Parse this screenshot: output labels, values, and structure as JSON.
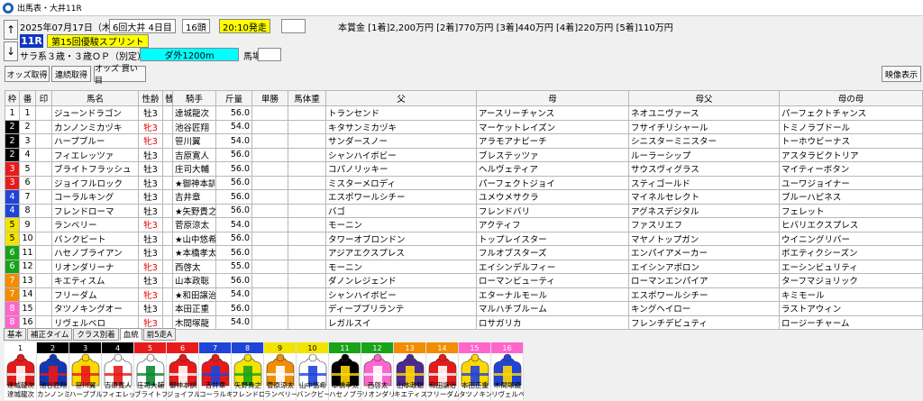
{
  "window": {
    "title": "出馬表・大井11R"
  },
  "header": {
    "date": "2025年07月17日（木）",
    "meeting": "6回大井 4日目",
    "runners": "16頭",
    "post_time": "20:10発走",
    "race_no": "11R",
    "race_name": "第15回優駿スプリント",
    "conditions": "サラ系３歳・３歳ＯＰ（別定）",
    "course": "ダ外1200m",
    "going_label": "馬場：",
    "prize": "本賞金 [1着]2,200万円 [2着]770万円 [3着]440万円 [4着]220万円 [5着]110万円"
  },
  "toolbar": {
    "odds_fetch": "オッズ取得",
    "auto_fetch": "連続取得",
    "odds_buy": "オッズ 買い目",
    "video": "映像表示"
  },
  "columns": [
    "枠",
    "番",
    "印",
    "馬名",
    "性齢",
    "替",
    "騎手",
    "斤量",
    "単勝",
    "馬体重",
    "父",
    "母",
    "母父",
    "母の母"
  ],
  "colors": {
    "frame": [
      "#ffffff",
      "#000000",
      "#e81b1b",
      "#1f44d8",
      "#f2e300",
      "#18a319",
      "#f28c00",
      "#ff66cc"
    ],
    "frame_text": [
      "#000000",
      "#ffffff",
      "#ffffff",
      "#ffffff",
      "#000000",
      "#ffffff",
      "#ffffff",
      "#ffffff"
    ],
    "accent": "#1136c2",
    "race_name_bg": "#ffff00",
    "course_bg": "#00ffff",
    "post_time_bg": "#ffff00"
  },
  "horses": [
    {
      "waku": 1,
      "num": "1",
      "name": "ジューンドラゴン",
      "sex": "牡3",
      "sw": "",
      "jockey": "達城龍次",
      "weight": "56.0",
      "sire": "トランセンド",
      "dam": "アースリーチャンス",
      "damsire": "ネオユニヴァース",
      "damdam": "パーフェクトチャンス"
    },
    {
      "waku": 2,
      "num": "2",
      "name": "カンノンミカヅキ",
      "sex": "牝3",
      "sw": "",
      "jockey": "池谷匠翔",
      "weight": "54.0",
      "sire": "キタサンミカヅキ",
      "dam": "マーケットレイズン",
      "damsire": "フサイチリシャール",
      "damdam": "トミノラブドール"
    },
    {
      "waku": 2,
      "num": "3",
      "name": "ハープブルー",
      "sex": "牝3",
      "sw": "",
      "jockey": "笹川翼",
      "weight": "54.0",
      "sire": "サンダースノー",
      "dam": "アラモアナビーチ",
      "damsire": "シニスターミニスター",
      "damdam": "トーホウビーナス"
    },
    {
      "waku": 2,
      "num": "4",
      "name": "フィエレッツァ",
      "sex": "牡3",
      "sw": "",
      "jockey": "吉原寛人",
      "weight": "56.0",
      "sire": "シャンハイボビー",
      "dam": "ブレステッツァ",
      "damsire": "ルーラーシップ",
      "damdam": "アスタラビクトリア"
    },
    {
      "waku": 3,
      "num": "5",
      "name": "ブライトフラッシュ",
      "sex": "牡3",
      "sw": "",
      "jockey": "庄司大輔",
      "weight": "56.0",
      "sire": "コパノリッキー",
      "dam": "ヘルヴェティア",
      "damsire": "サウスヴィグラス",
      "damdam": "マイティーボタン"
    },
    {
      "waku": 3,
      "num": "6",
      "name": "ジョイフルロック",
      "sex": "牡3",
      "sw": "",
      "jockey": "★御神本訓",
      "weight": "56.0",
      "sire": "ミスターメロディ",
      "dam": "パーフェクトジョイ",
      "damsire": "スティゴールド",
      "damdam": "ユーワジョイナー"
    },
    {
      "waku": 4,
      "num": "7",
      "name": "コーラルキング",
      "sex": "牡3",
      "sw": "",
      "jockey": "吉井章",
      "weight": "56.0",
      "sire": "エスポワールシチー",
      "dam": "ユメウメサクラ",
      "damsire": "マイネルセレクト",
      "damdam": "ブルーハピネス"
    },
    {
      "waku": 4,
      "num": "8",
      "name": "フレンドローマ",
      "sex": "牡3",
      "sw": "",
      "jockey": "★矢野貴之",
      "weight": "56.0",
      "sire": "バゴ",
      "dam": "フレンドバリ",
      "damsire": "アグネスデジタル",
      "damdam": "フェレット"
    },
    {
      "waku": 5,
      "num": "9",
      "name": "ランベリー",
      "sex": "牝3",
      "sw": "",
      "jockey": "菅原涼太",
      "weight": "54.0",
      "sire": "モーニン",
      "dam": "アクティフ",
      "damsire": "ファスリエフ",
      "damdam": "ヒバリエクスプレス"
    },
    {
      "waku": 5,
      "num": "10",
      "name": "バンクビート",
      "sex": "牡3",
      "sw": "",
      "jockey": "★山中悠希",
      "weight": "56.0",
      "sire": "タワーオブロンドン",
      "dam": "トップレイスター",
      "damsire": "マヤノトップガン",
      "damdam": "ウイニングリバー"
    },
    {
      "waku": 6,
      "num": "11",
      "name": "ハセノブライアン",
      "sex": "牡3",
      "sw": "",
      "jockey": "★本橋孝太",
      "weight": "56.0",
      "sire": "アジアエクスプレス",
      "dam": "フルオブスターズ",
      "damsire": "エンパイアメーカー",
      "damdam": "ボエティクシーズン"
    },
    {
      "waku": 6,
      "num": "12",
      "name": "リオンダリーナ",
      "sex": "牝3",
      "sw": "",
      "jockey": "西啓太",
      "weight": "55.0",
      "sire": "モーニン",
      "dam": "エイシンデルフィー",
      "damsire": "エイシンアポロン",
      "damdam": "エーシンビュリティ"
    },
    {
      "waku": 7,
      "num": "13",
      "name": "キエティスム",
      "sex": "牡3",
      "sw": "",
      "jockey": "山本政聡",
      "weight": "56.0",
      "sire": "ダノンレジェンド",
      "dam": "ローマンビューティ",
      "damsire": "ローマンエンパイア",
      "damdam": "ターフマジョリック"
    },
    {
      "waku": 7,
      "num": "14",
      "name": "フリーダム",
      "sex": "牝3",
      "sw": "",
      "jockey": "★和田譲治",
      "weight": "54.0",
      "sire": "シャンハイボビー",
      "dam": "エターナルモール",
      "damsire": "エスポワールシチー",
      "damdam": "キミモール"
    },
    {
      "waku": 8,
      "num": "15",
      "name": "タツノキングオー",
      "sex": "牡3",
      "sw": "",
      "jockey": "本田正重",
      "weight": "56.0",
      "sire": "ディープブリランテ",
      "dam": "マルハチブルーム",
      "damsire": "キングヘイロー",
      "damdam": "ラストアウィン"
    },
    {
      "waku": 8,
      "num": "16",
      "name": "リヴェルベロ",
      "sex": "牝3",
      "sw": "",
      "jockey": "木間塚龍",
      "weight": "54.0",
      "sire": "レガルスイ",
      "dam": "ロサガリカ",
      "damsire": "フレンチデビュティ",
      "damdam": "ロージーチャーム"
    }
  ],
  "tabs": [
    "基本",
    "補正タイム",
    "クラス別着",
    "血統",
    "前5走A"
  ],
  "active_tab": "血統",
  "silks": [
    {
      "num": "1",
      "name": "達城龍次"
    },
    {
      "num": "2",
      "name": "カンノンミ"
    },
    {
      "num": "3",
      "name": "ハーブブル"
    },
    {
      "num": "4",
      "name": "フィエレッ"
    },
    {
      "num": "5",
      "name": "ブライトフ"
    },
    {
      "num": "6",
      "name": "ジョイフル"
    },
    {
      "num": "7",
      "name": "コーラルキ"
    },
    {
      "num": "8",
      "name": "フレンドロ"
    },
    {
      "num": "9",
      "name": "ランベリー"
    },
    {
      "num": "10",
      "name": "バンクビー"
    },
    {
      "num": "11",
      "name": "ハセノブラ"
    },
    {
      "num": "12",
      "name": "リオンダリ"
    },
    {
      "num": "13",
      "name": "キエティス"
    },
    {
      "num": "14",
      "name": "フリーダム"
    },
    {
      "num": "15",
      "name": "タツノキン"
    },
    {
      "num": "16",
      "name": "リヴェルベ"
    }
  ],
  "silk_names_top": [
    "達城龍次",
    "池谷匠翔",
    "笹川翼",
    "吉原寛人",
    "庄司大輔",
    "御神本訓",
    "吉井章",
    "矢野貴之",
    "菅原涼太",
    "山中悠希",
    "本橋孝太",
    "西啓太",
    "山本政聡",
    "和田譲治",
    "本田正重",
    "木間塚龍"
  ]
}
